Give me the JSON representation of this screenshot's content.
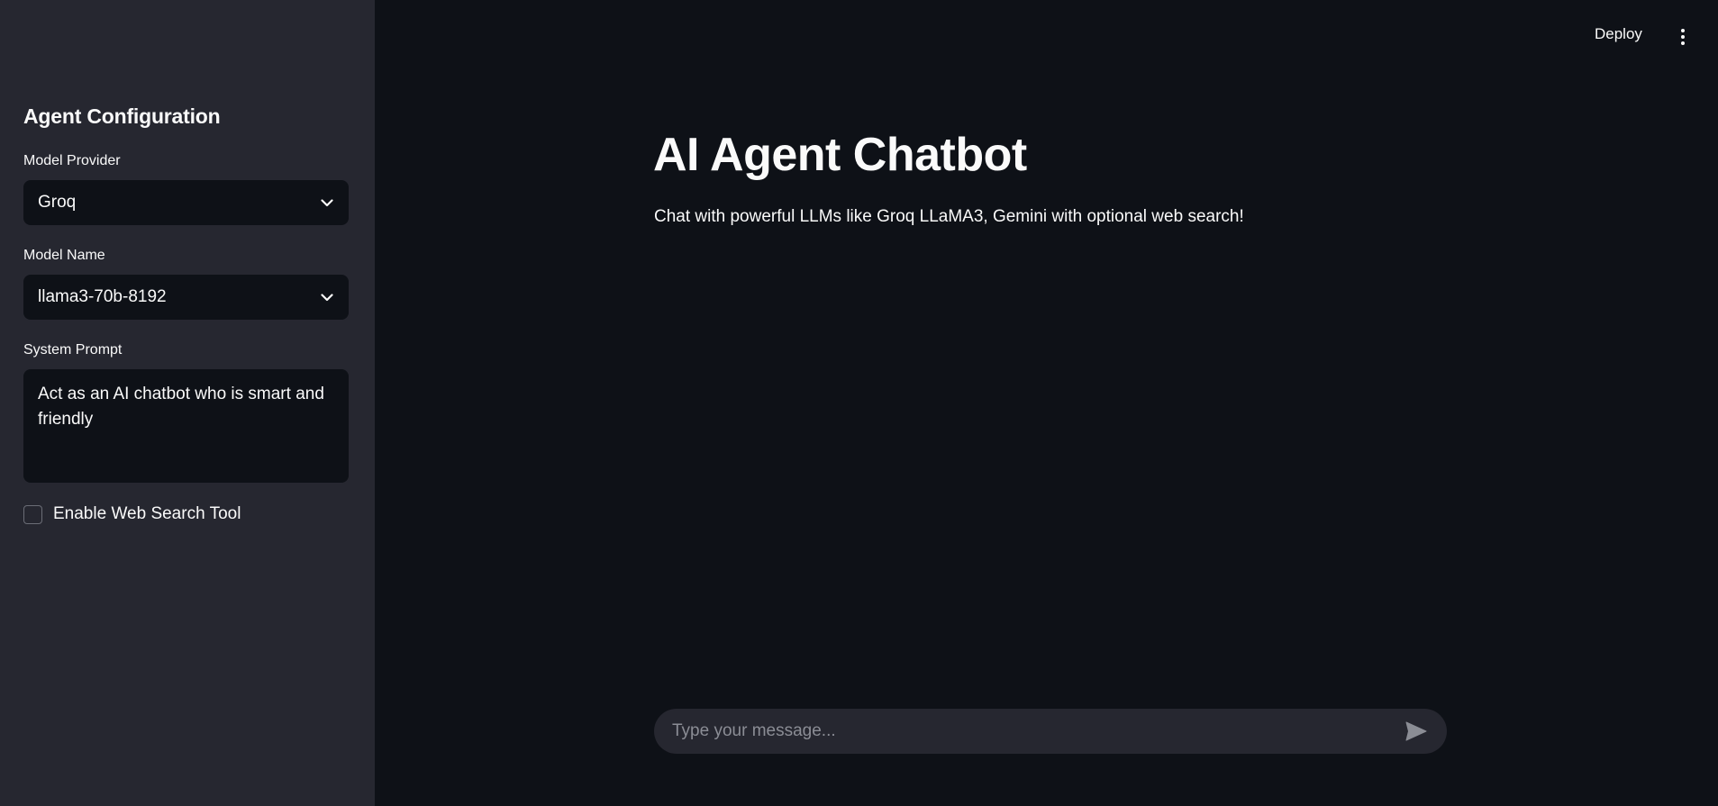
{
  "header": {
    "deploy_label": "Deploy",
    "menu_icon": "kebab-menu-icon"
  },
  "sidebar": {
    "title": "Agent Configuration",
    "model_provider": {
      "label": "Model Provider",
      "value": "Groq"
    },
    "model_name": {
      "label": "Model Name",
      "value": "llama3-70b-8192"
    },
    "system_prompt": {
      "label": "System Prompt",
      "value": "Act as an AI chatbot who is smart and friendly"
    },
    "web_search": {
      "label": "Enable Web Search Tool",
      "checked": false
    }
  },
  "main": {
    "title": "AI Agent Chatbot",
    "subtitle": "Chat with powerful LLMs like Groq LLaMA3, Gemini with optional web search!"
  },
  "chat": {
    "placeholder": "Type your message...",
    "send_icon": "send-icon"
  },
  "colors": {
    "background": "#0e1117",
    "sidebar": "#262730",
    "text": "#fafafa",
    "placeholder": "#8b8d95"
  }
}
